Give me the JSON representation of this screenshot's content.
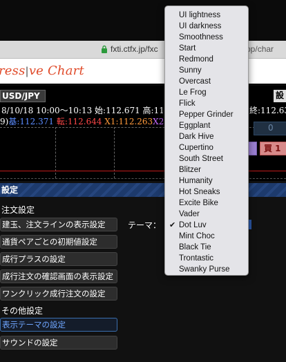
{
  "browser": {
    "url_prefix": "fxti.ctfx.jp/fxc",
    "url_suffix": "/app/char"
  },
  "logo": {
    "left": "ress",
    "right": "ve Chart"
  },
  "chart": {
    "pair": "USD/JPY",
    "right_tab": "設",
    "info_line": "8/10/18 10:00〜10:13 始:112.671 高:11",
    "info_line_tail": "終:112.63",
    "line2_prefix": "9)",
    "line2_blue": "基:112.371",
    "line2_red": "転:112.644",
    "line2_orange": "X1:112.263",
    "line2_purple": "X2",
    "right_value": "0",
    "buy_label": "買 1"
  },
  "settings": {
    "header": "設定",
    "section_order": "注文設定",
    "items_order": [
      "建玉、注文ラインの表示設定",
      "通貨ペアごとの初期値設定",
      "成行プラスの設定",
      "成行注文の確認画面の表示設定",
      "ワンクリック成行注文の設定"
    ],
    "section_other": "その他設定",
    "items_other": [
      "表示テーマの設定",
      "サウンドの設定"
    ],
    "theme_label": "テーマ："
  },
  "menu": {
    "selected": "Dot Luv",
    "options": [
      "UI lightness",
      "UI darkness",
      "Smoothness",
      "Start",
      "Redmond",
      "Sunny",
      "Overcast",
      "Le Frog",
      "Flick",
      "Pepper Grinder",
      "Eggplant",
      "Dark Hive",
      "Cupertino",
      "South Street",
      "Blitzer",
      "Humanity",
      "Hot Sneaks",
      "Excite Bike",
      "Vader",
      "Dot Luv",
      "Mint Choc",
      "Black Tie",
      "Trontastic",
      "Swanky Purse"
    ]
  }
}
